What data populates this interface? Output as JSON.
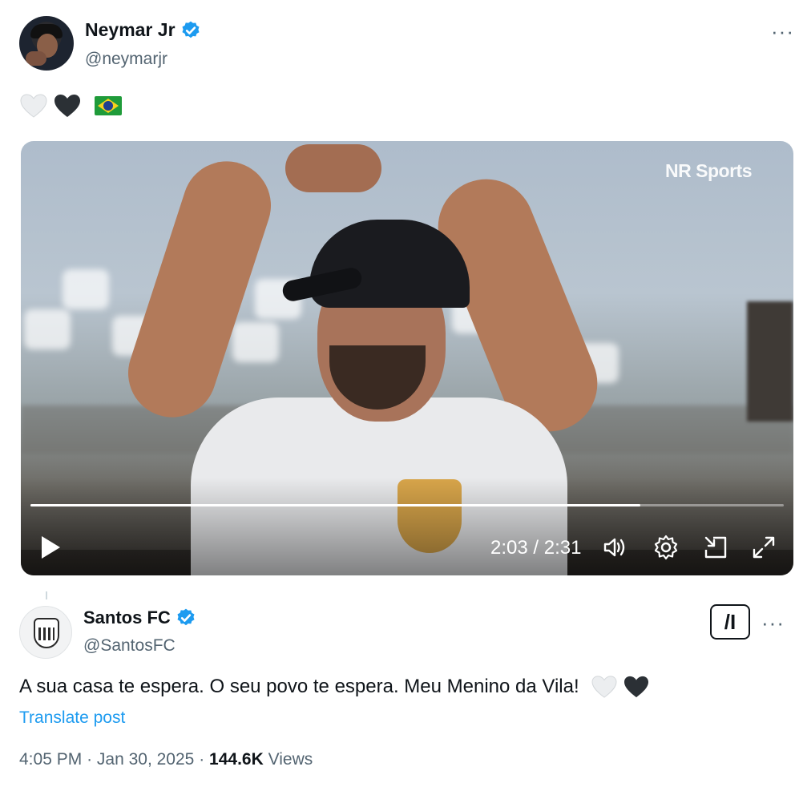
{
  "original_post": {
    "author": {
      "display_name": "Neymar Jr",
      "handle": "@neymarjr",
      "verified": true
    },
    "text_emojis": [
      "white-heart",
      "black-heart",
      "brazil-flag"
    ],
    "video": {
      "watermark": "NR Sports",
      "current_time": "2:03",
      "duration": "2:31",
      "time_separator": "/",
      "progress_fraction": 0.81,
      "state": "paused",
      "controls": [
        "play-icon",
        "volume-icon",
        "settings-icon",
        "pip-icon",
        "fullscreen-icon"
      ]
    }
  },
  "reply_post": {
    "author": {
      "display_name": "Santos FC",
      "handle": "@SantosFC",
      "verified": true
    },
    "grok_label": "/I",
    "text": "A sua casa te espera. O seu povo te espera. Meu Menino da Vila!",
    "text_emojis": [
      "white-heart",
      "black-heart"
    ],
    "translate_label": "Translate post",
    "time": "4:05 PM",
    "date": "Jan 30, 2025",
    "views_count": "144.6K",
    "views_label": "Views",
    "separator": "·"
  },
  "colors": {
    "verified_blue": "#1d9bf0",
    "link_blue": "#1d9bf0",
    "secondary_text": "#536471",
    "primary_text": "#0f1419"
  }
}
